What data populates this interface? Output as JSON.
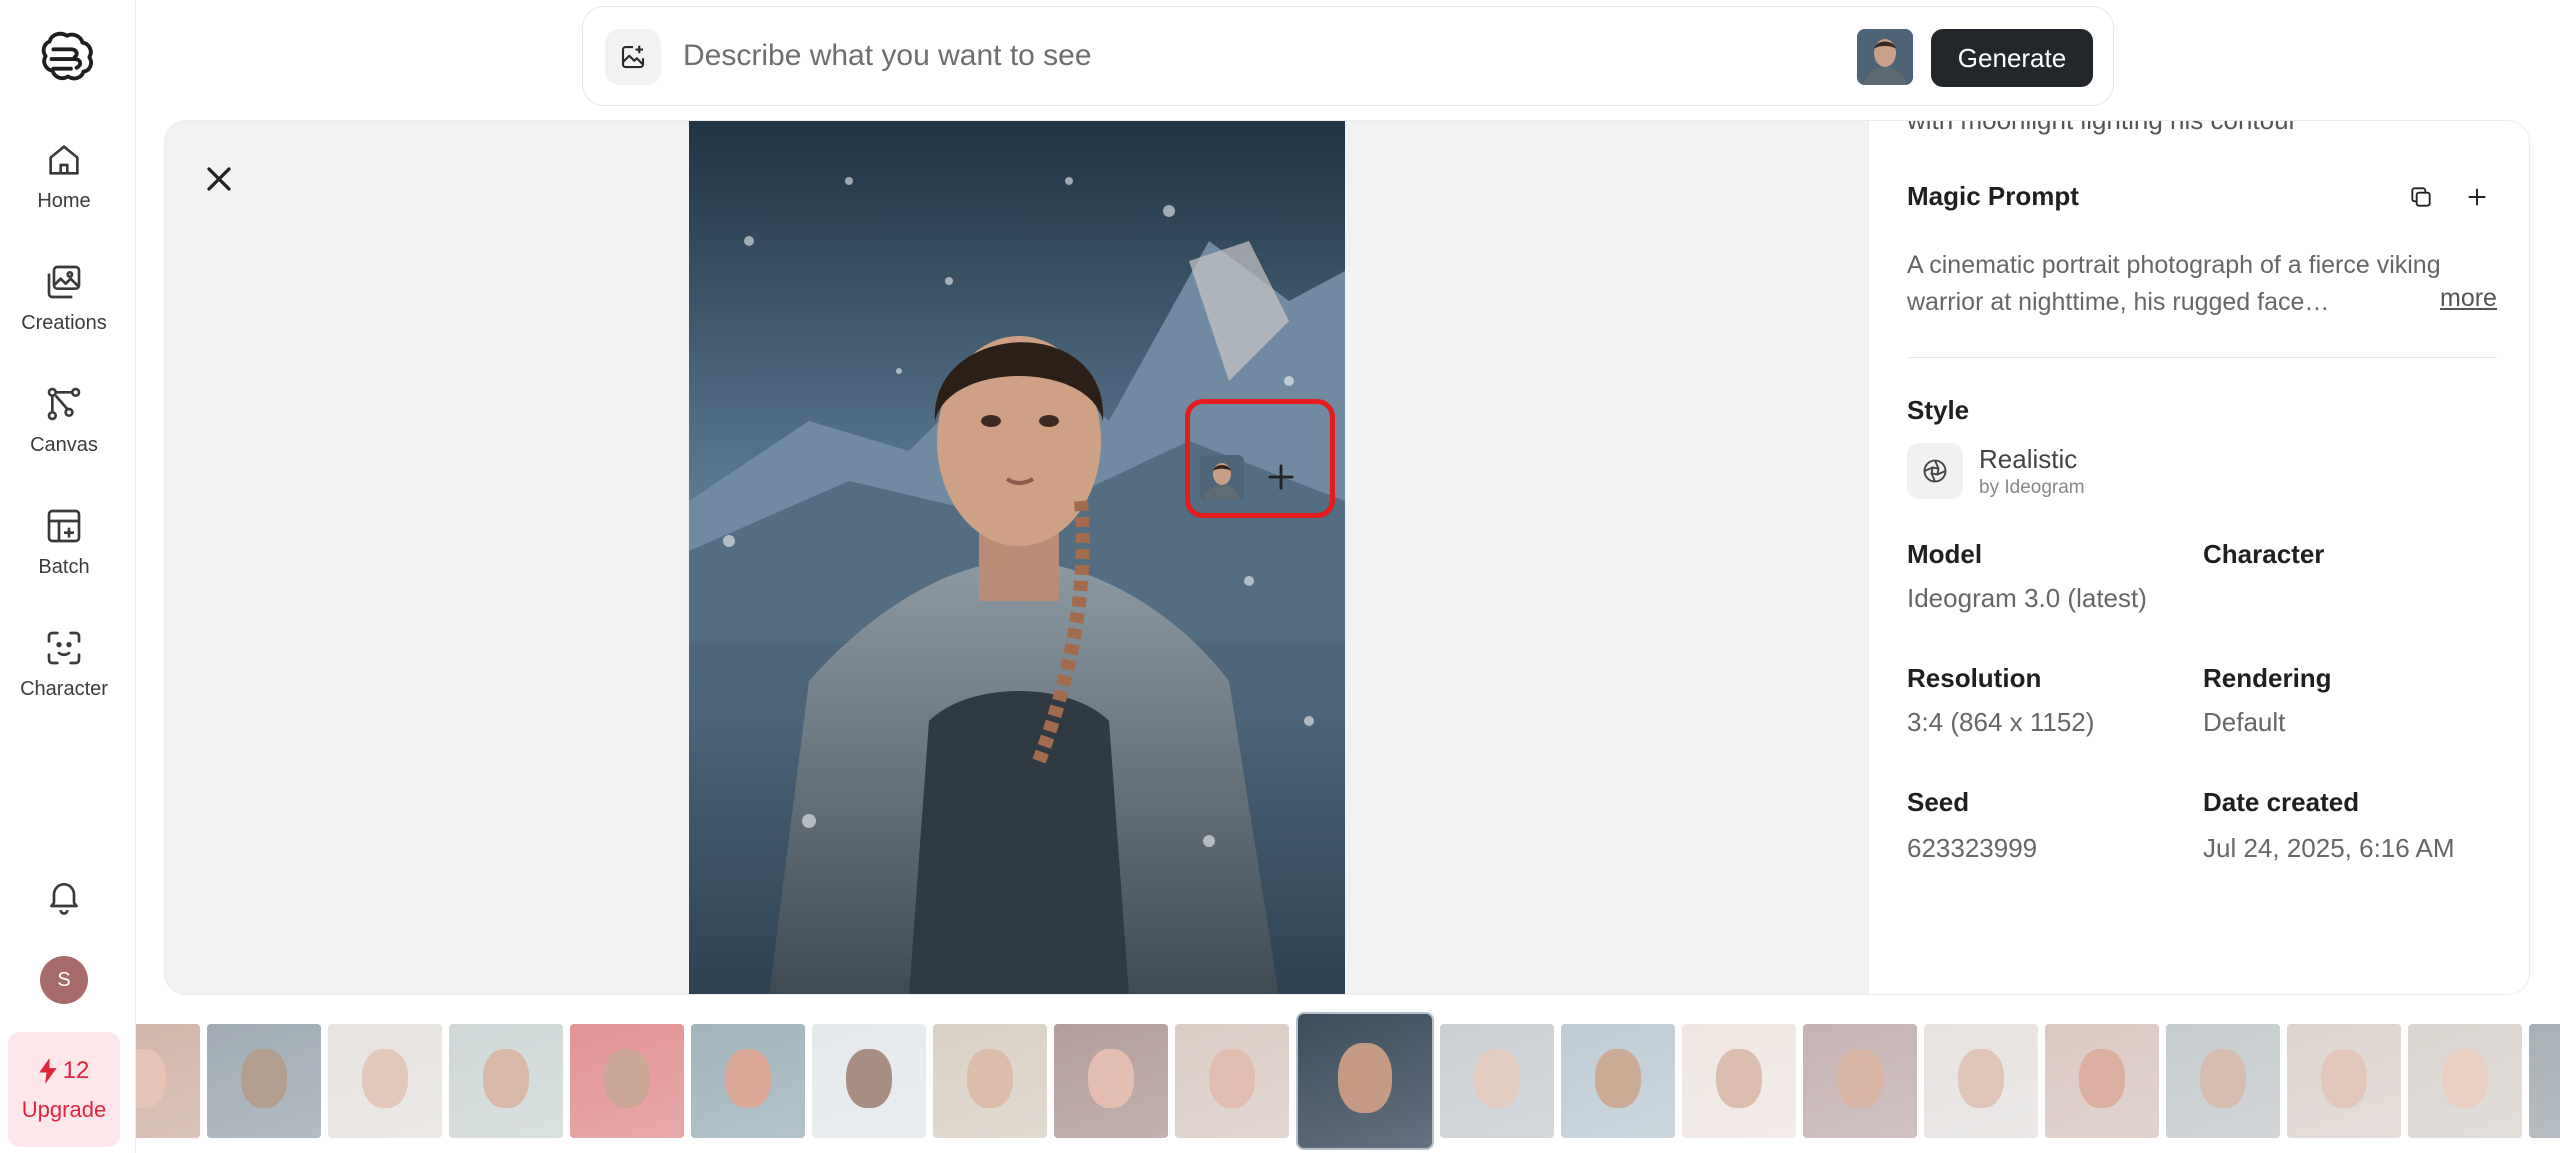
{
  "sidebar": {
    "items": [
      {
        "label": "Home",
        "icon": "home-icon"
      },
      {
        "label": "Creations",
        "icon": "images-icon"
      },
      {
        "label": "Canvas",
        "icon": "canvas-icon"
      },
      {
        "label": "Batch",
        "icon": "batch-icon"
      },
      {
        "label": "Character",
        "icon": "character-icon"
      }
    ],
    "avatar_initial": "S",
    "credits": "12",
    "upgrade_label": "Upgrade"
  },
  "topbar": {
    "placeholder": "Describe what you want to see",
    "generate_label": "Generate"
  },
  "details": {
    "cut_text": "with moonlight lighting his contour",
    "magic_prompt_title": "Magic Prompt",
    "magic_prompt_text": "A cinematic portrait photograph of a fierce viking warrior at nighttime, his rugged face…",
    "more_label": "more",
    "style_title": "Style",
    "style_name": "Realistic",
    "style_by": "by Ideogram",
    "model_title": "Model",
    "model_value": "Ideogram 3.0 (latest)",
    "character_title": "Character",
    "resolution_title": "Resolution",
    "resolution_value": "3:4 (864 x 1152)",
    "rendering_title": "Rendering",
    "rendering_value": "Default",
    "seed_title": "Seed",
    "seed_value": "623323999",
    "date_title": "Date created",
    "date_value": "Jul 24, 2025, 6:16 AM"
  },
  "colors": {
    "accent_dark": "#23272b",
    "highlight_red": "#e61c1c",
    "upgrade_bg": "#fde7ea",
    "upgrade_text": "#e2243b"
  },
  "thumbnails": [
    {
      "bg": "#b98b78",
      "face": "#d7a58e"
    },
    {
      "bg": "#6f7f8c",
      "face": "#8a6a55"
    },
    {
      "bg": "#d9d4cf",
      "face": "#d8ab98"
    },
    {
      "bg": "#b7c4c4",
      "face": "#c79378"
    },
    {
      "bg": "#d45a5a",
      "face": "#b07a5e"
    },
    {
      "bg": "#6f8c99",
      "face": "#c97a62"
    },
    {
      "bg": "#d7dde2",
      "face": "#7a5240"
    },
    {
      "bg": "#c7b9a8",
      "face": "#c99a7c"
    },
    {
      "bg": "#8c6a66",
      "face": "#d59a86"
    },
    {
      "bg": "#c9b3a8",
      "face": "#d49a84"
    },
    {
      "bg": "#3d4d5d",
      "face": "#c49a84",
      "selected": true
    },
    {
      "bg": "#b0b6bd",
      "face": "#d6b39e"
    },
    {
      "bg": "#9db1bf",
      "face": "#b07f5f"
    },
    {
      "bg": "#e7d9d2",
      "face": "#c99c84"
    },
    {
      "bg": "#a7898a",
      "face": "#c48d72"
    },
    {
      "bg": "#d8d3d0",
      "face": "#d3a694"
    },
    {
      "bg": "#c8aca3",
      "face": "#c8846c"
    },
    {
      "bg": "#a8b0b5",
      "face": "#c29a86"
    },
    {
      "bg": "#cdbfb7",
      "face": "#d5aa96"
    },
    {
      "bg": "#c9c0b9",
      "face": "#e0b8a3"
    },
    {
      "bg": "#7a8790",
      "face": "#b58d78"
    }
  ]
}
